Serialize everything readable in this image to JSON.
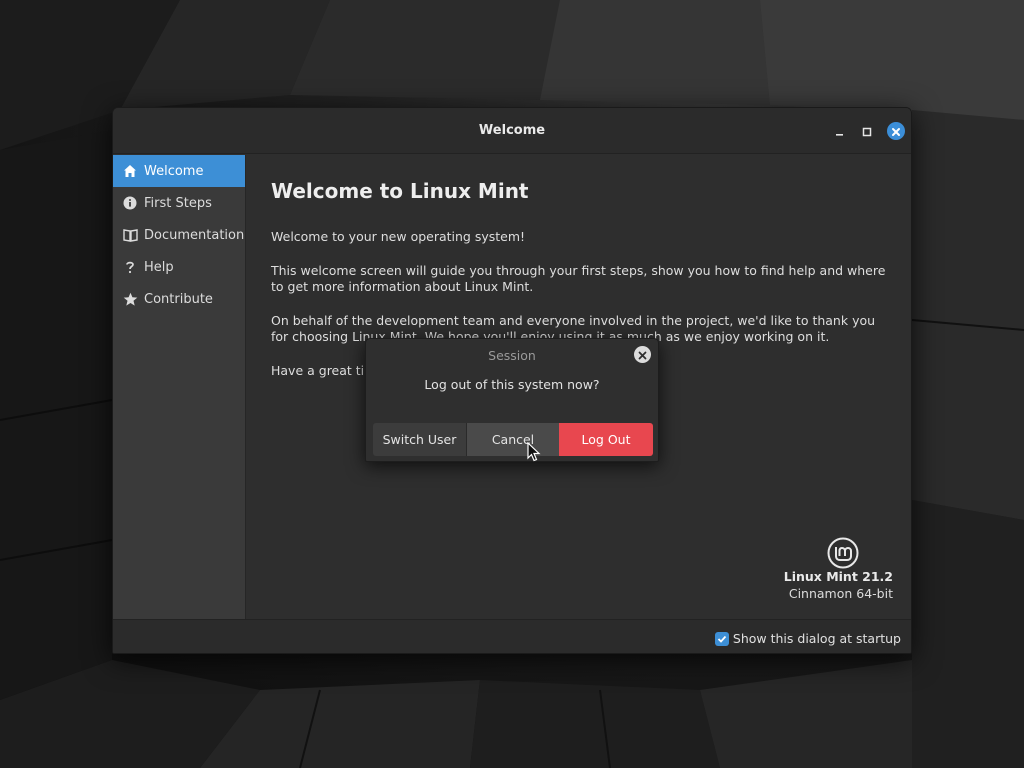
{
  "window": {
    "title": "Welcome"
  },
  "sidebar": {
    "items": [
      {
        "label": "Welcome",
        "icon": "home-icon",
        "active": true
      },
      {
        "label": "First Steps",
        "icon": "info-icon",
        "active": false
      },
      {
        "label": "Documentation",
        "icon": "book-icon",
        "active": false
      },
      {
        "label": "Help",
        "icon": "question-icon",
        "active": false
      },
      {
        "label": "Contribute",
        "icon": "star-icon",
        "active": false
      }
    ]
  },
  "content": {
    "heading": "Welcome to Linux Mint",
    "paragraphs": [
      "Welcome to your new operating system!",
      "This welcome screen will guide you through your first steps, show you how to find help and where to get more information about Linux Mint.",
      "On behalf of the development team and everyone involved in the project, we'd like to thank you for choosing Linux Mint. We hope you'll enjoy using it as much as we enjoy working on it.",
      "Have a great tim"
    ],
    "version_name": "Linux Mint 21.2",
    "edition": "Cinnamon 64-bit"
  },
  "footer": {
    "startup_label": "Show this dialog at startup",
    "startup_checked": true
  },
  "dialog": {
    "title": "Session",
    "message": "Log out of this system now?",
    "buttons": {
      "switch_user": "Switch User",
      "cancel": "Cancel",
      "log_out": "Log Out"
    }
  },
  "colors": {
    "accent": "#3d8fd6",
    "danger": "#e8474f",
    "window_bg": "#2e2e2e",
    "sidebar_bg": "#3a3a3a"
  }
}
